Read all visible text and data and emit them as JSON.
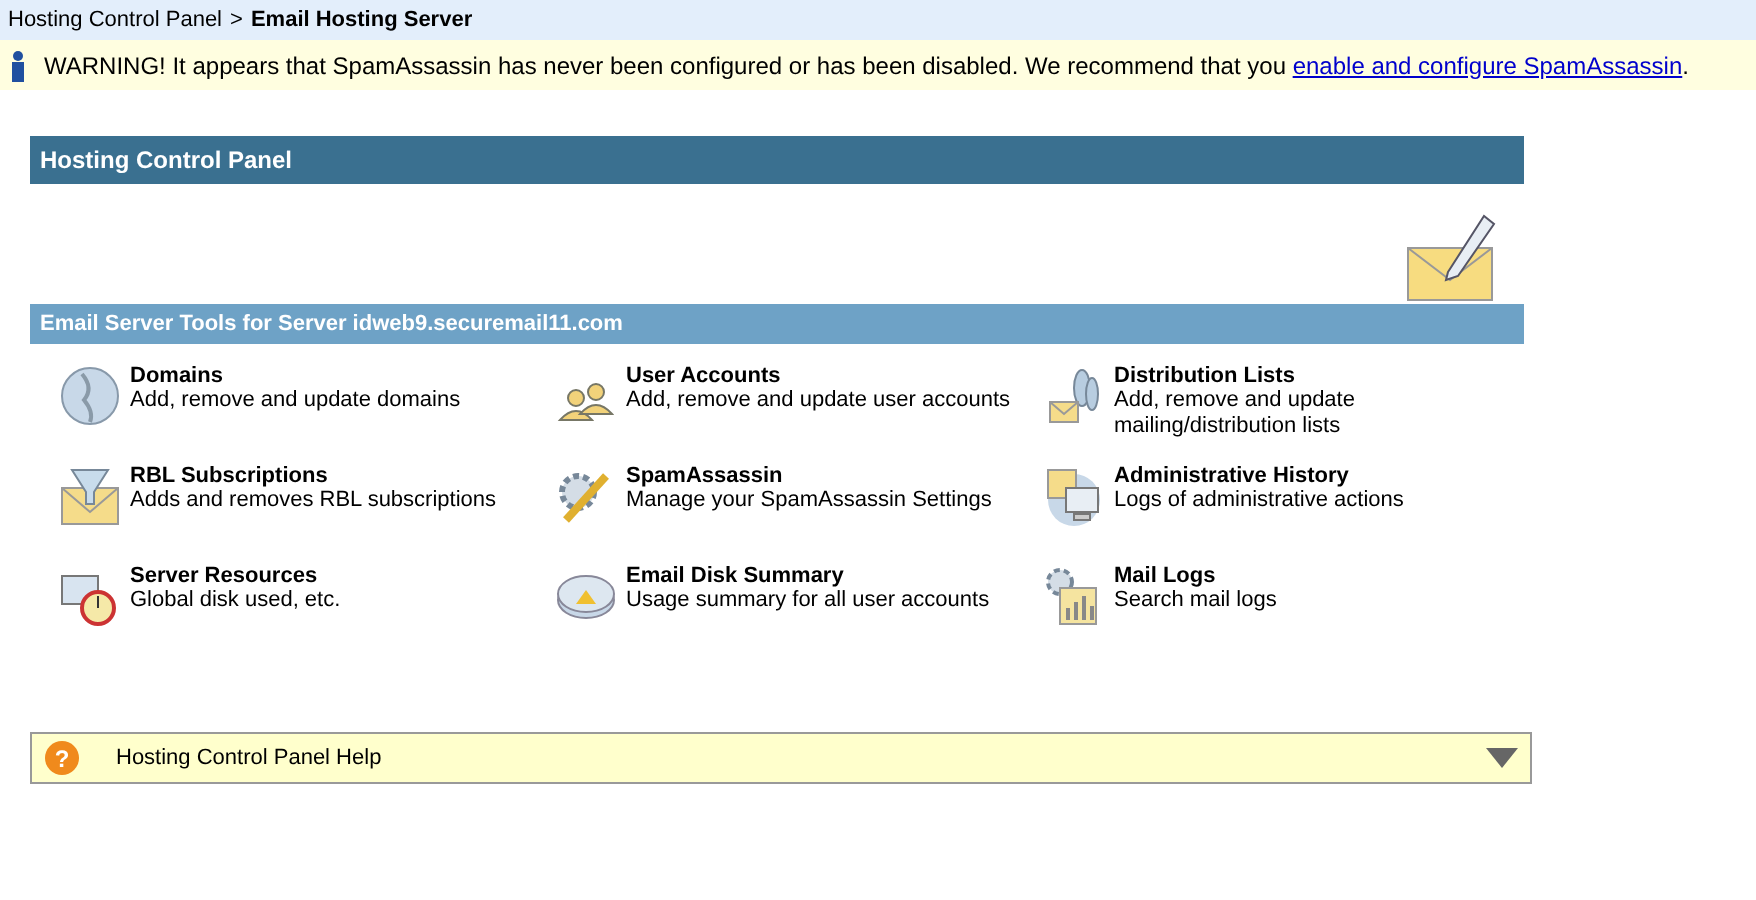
{
  "breadcrumb": {
    "parent": "Hosting Control Panel",
    "separator": ">",
    "current": "Email Hosting Server"
  },
  "warning": {
    "text": "WARNING! It appears that SpamAssassin has never been configured or has been disabled. We recommend that you ",
    "link": "enable and configure SpamAssassin",
    "end": "."
  },
  "panel": {
    "title": "Hosting Control Panel"
  },
  "tools": {
    "title": "Email Server Tools for Server idweb9.securemail11.com",
    "items": [
      {
        "kind": "globe",
        "title": "Domains",
        "desc": [
          "Add, remove and update domains"
        ]
      },
      {
        "kind": "users",
        "title": "User Accounts",
        "desc": [
          "Add, remove and update user accounts"
        ]
      },
      {
        "kind": "distribution",
        "title": "Distribution Lists",
        "desc": [
          "Add, remove and update",
          "mailing/distribution lists"
        ]
      },
      {
        "kind": "filter",
        "title": "RBL Subscriptions",
        "desc": [
          "Adds and removes RBL subscriptions"
        ]
      },
      {
        "kind": "tools",
        "title": "SpamAssassin",
        "desc": [
          "Manage your SpamAssassin Settings"
        ]
      },
      {
        "kind": "history",
        "title": "Administrative History",
        "desc": [
          "Logs of administrative actions"
        ]
      },
      {
        "kind": "monitor",
        "title": "Server Resources",
        "desc": [
          "Global disk used, etc."
        ]
      },
      {
        "kind": "disk",
        "title": "Email Disk Summary",
        "desc": [
          "Usage summary for all user accounts"
        ]
      },
      {
        "kind": "logs",
        "title": "Mail Logs",
        "desc": [
          "Search mail logs"
        ]
      }
    ]
  },
  "help": {
    "icon": "?",
    "title": "Hosting Control Panel Help",
    "expanded": false
  }
}
